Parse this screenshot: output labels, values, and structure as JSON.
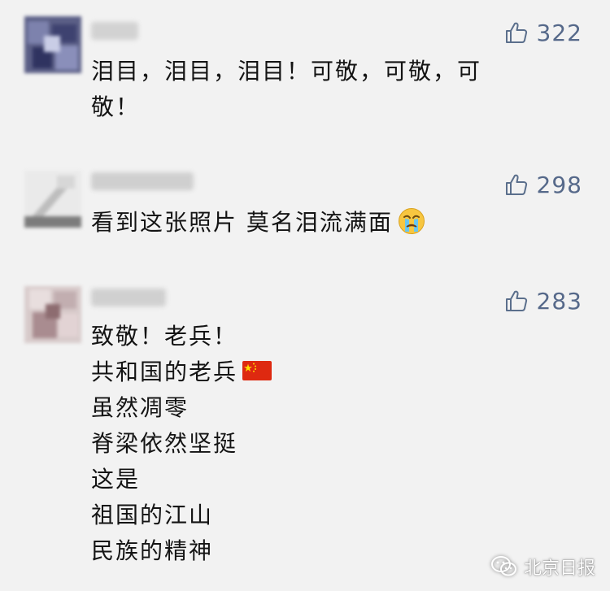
{
  "comments": [
    {
      "likes": "322",
      "lines": [
        "泪目，泪目，泪目！可敬，可敬，可",
        "敬！"
      ]
    },
    {
      "likes": "298",
      "lines": [
        "看到这张照片 莫名泪流满面"
      ]
    },
    {
      "likes": "283",
      "lines": [
        "致敬！老兵！",
        "共和国的老兵",
        "虽然凋零",
        "脊梁依然坚挺",
        "这是",
        "祖国的江山",
        "民族的精神"
      ]
    }
  ],
  "icons": {
    "like": "thumbs-up-icon",
    "emoji": "crying-face-icon",
    "flag": "china-flag-icon",
    "watermark_logo": "wechat-icon"
  },
  "watermark": {
    "text": "北京日报"
  },
  "colors": {
    "background": "#f2f2f2",
    "like_color": "#56698a",
    "text": "#141414"
  }
}
